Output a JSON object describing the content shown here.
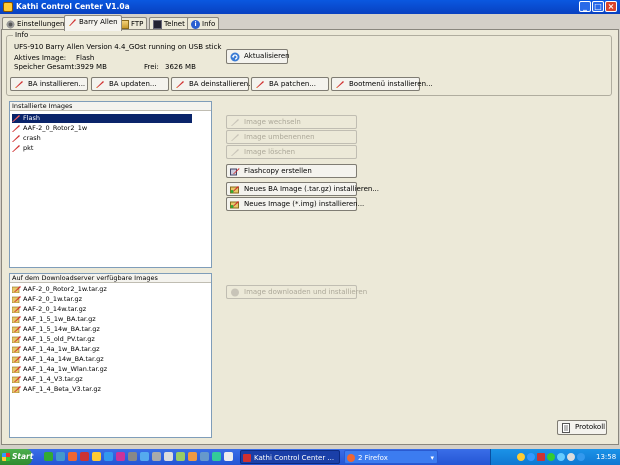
{
  "window": {
    "title": "Kathi Control Center V1.0a",
    "buttons": {
      "minimize": "_",
      "maximize": "□",
      "close": "×"
    }
  },
  "tabs": [
    {
      "label": "Einstellungen",
      "icon": "settings-icon"
    },
    {
      "label": "Barry Allen",
      "icon": "flash-icon",
      "active": true
    },
    {
      "label": "FTP",
      "icon": "ftp-icon"
    },
    {
      "label": "Telnet",
      "icon": "telnet-icon"
    },
    {
      "label": "Info",
      "icon": "info-icon"
    }
  ],
  "info": {
    "group_label": "Info",
    "status_line": "UFS-910 Barry Allen Version 4.4_GOst running on USB stick",
    "active_image_label": "Aktives Image:",
    "active_image_value": "Flash",
    "storage_total_label": "Speicher Gesamt:",
    "storage_total_value": "3929 MB",
    "storage_free_label": "Frei:",
    "storage_free_value": "3626 MB",
    "refresh_button": "Aktualisieren"
  },
  "ba_buttons": [
    "BA installieren...",
    "BA updaten...",
    "BA deinstallieren...",
    "BA patchen...",
    "Bootmenü installieren..."
  ],
  "installed": {
    "header": "Installierte Images",
    "items": [
      "Flash",
      "AAF-2_0_Rotor2_1w",
      "crash",
      "pkt"
    ],
    "selected_index": 0
  },
  "image_actions": {
    "switch": "Image wechseln",
    "rename": "Image umbenennen",
    "delete": "Image löschen",
    "flashcopy": "Flashcopy erstellen",
    "new_ba": "Neues BA Image (.tar.gz) installieren...",
    "new_img": "Neues Image (*.img) installieren..."
  },
  "downloads": {
    "header": "Auf dem Downloadserver verfügbare Images",
    "items": [
      "AAF-2_0_Rotor2_1w.tar.gz",
      "AAF-2_0_1w.tar.gz",
      "AAF-2_0_14w.tar.gz",
      "AAF_1_5_1w_BA.tar.gz",
      "AAF_1_5_14w_BA.tar.gz",
      "AAF_1_5_old_PV.tar.gz",
      "AAF_1_4a_1w_BA.tar.gz",
      "AAF_1_4a_14w_BA.tar.gz",
      "AAF_1_4a_1w_Wlan.tar.gz",
      "AAF_1_4_V3.tar.gz",
      "AAF_1_4_Beta_V3.tar.gz"
    ],
    "download_button": "Image downloaden und installieren"
  },
  "protocol_button": "Protokoll",
  "taskbar": {
    "start": "Start",
    "tasks": [
      {
        "label": "Kathi Control Center ..."
      },
      {
        "label": "2 Firefox"
      }
    ],
    "clock": "13:58"
  },
  "colors": {
    "title_bar": "#0a58e0",
    "selection": "#0a246a",
    "panel": "#ece9d8",
    "taskbar": "#2455d4"
  }
}
